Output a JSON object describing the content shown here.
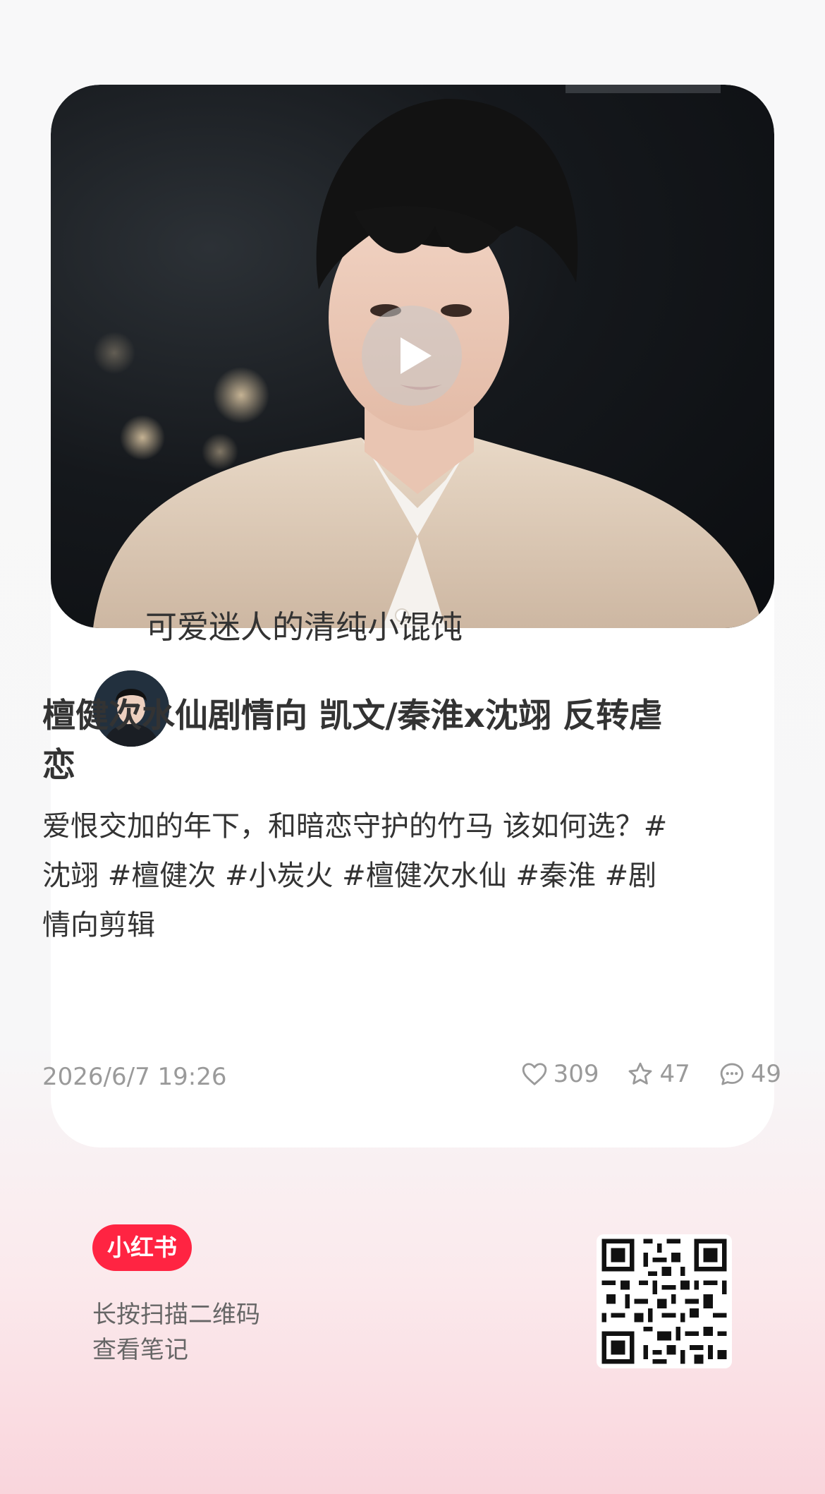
{
  "author": {
    "name": "可爱迷人的清纯小馄饨"
  },
  "note": {
    "title": "檀健次水仙剧情向 凯文/秦淮x沈翊 反转虐恋",
    "description": "爱恨交加的年下，和暗恋守护的竹马  该如何选？#沈翊  #檀健次  #小炭火  #檀健次水仙   #秦淮  #剧情向剪辑",
    "date": "2026/6/7 19:26",
    "likes": "309",
    "favorites": "47",
    "comments": "49"
  },
  "footer": {
    "brand": "小红书",
    "hint_line1": "长按扫描二维码",
    "hint_line2": "查看笔记"
  },
  "colors": {
    "brand": "#ff2442",
    "text": "#333333",
    "muted": "#999999"
  },
  "icons": [
    "play-icon",
    "heart-icon",
    "star-icon",
    "comment-icon"
  ]
}
